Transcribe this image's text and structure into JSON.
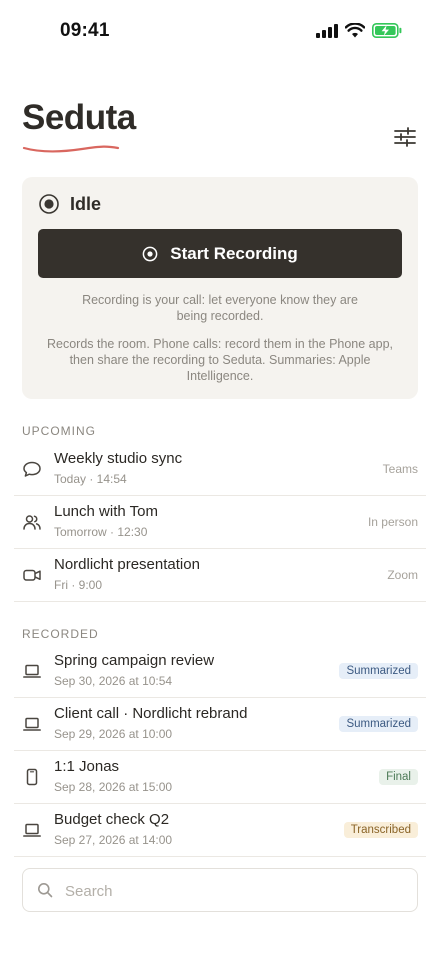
{
  "status_bar": {
    "time": "09:41"
  },
  "header": {
    "title": "Seduta"
  },
  "recorder": {
    "state": "Idle",
    "button_label": "Start Recording",
    "note_consent": "Recording is your call: let everyone know they are being recorded.",
    "note_info": "Records the room. Phone calls: record them in the Phone app, then share the recording to Seduta. Summaries: Apple Intelligence."
  },
  "upcoming": {
    "header": "UPCOMING",
    "items": [
      {
        "title": "Weekly studio sync",
        "subtitle": "Today · 14:54",
        "location": "Teams",
        "icon": "chat-bubble-icon"
      },
      {
        "title": "Lunch with Tom",
        "subtitle": "Tomorrow · 12:30",
        "location": "In person",
        "icon": "people-icon"
      },
      {
        "title": "Nordlicht presentation",
        "subtitle": "Fri · 9:00",
        "location": "Zoom",
        "icon": "video-camera-icon"
      }
    ]
  },
  "recorded": {
    "header": "RECORDED",
    "items": [
      {
        "title": "Spring campaign review",
        "subtitle": "Sep 30, 2026 at 10:54",
        "status": "Summarized",
        "icon": "laptop-icon"
      },
      {
        "title": "Client call · Nordlicht rebrand",
        "subtitle": "Sep 29, 2026 at 10:00",
        "status": "Summarized",
        "icon": "laptop-icon"
      },
      {
        "title": "1:1 Jonas",
        "subtitle": "Sep 28, 2026 at 15:00",
        "status": "Final",
        "icon": "phone-icon"
      },
      {
        "title": "Budget check Q2",
        "subtitle": "Sep 27, 2026 at 14:00",
        "status": "Transcribed",
        "icon": "laptop-icon"
      }
    ]
  },
  "search": {
    "placeholder": "Search"
  },
  "colors": {
    "accent_underline": "#d9675f",
    "button_bg": "#35312c",
    "card_bg": "#f5f3ef",
    "battery": "#34c759"
  }
}
